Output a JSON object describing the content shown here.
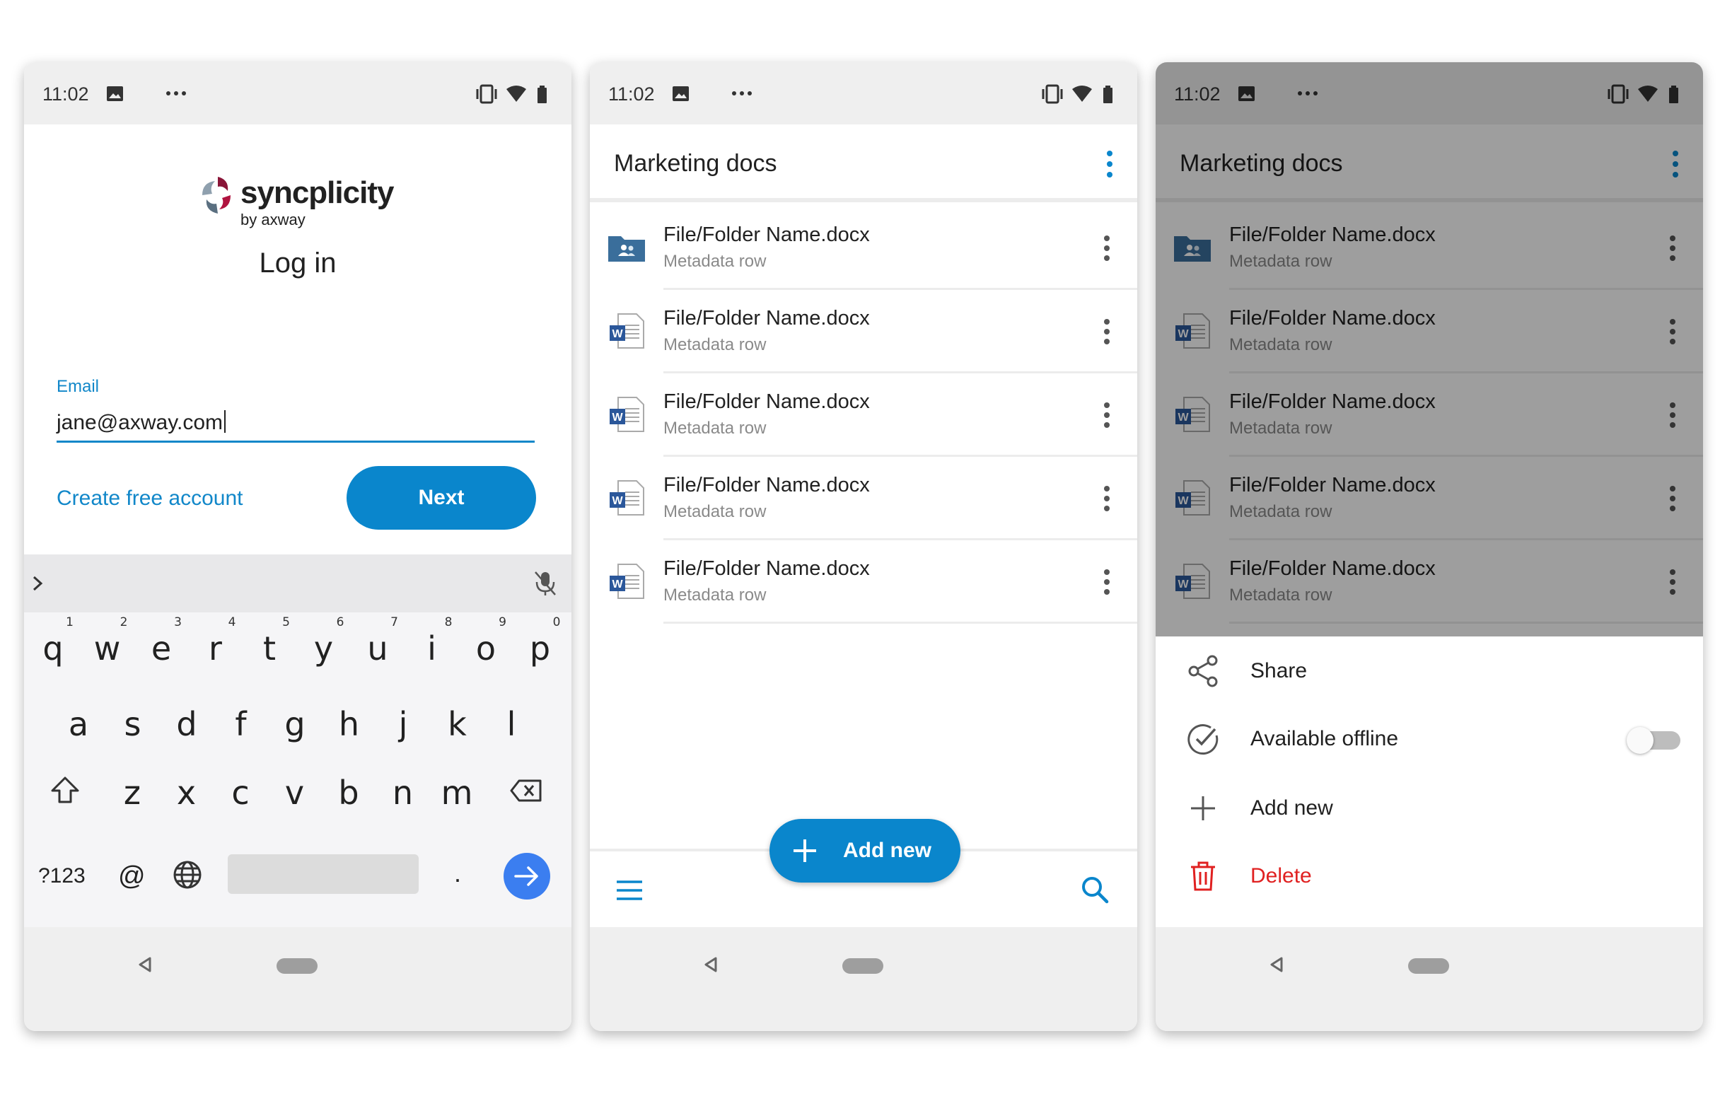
{
  "status": {
    "time": "11:02",
    "more": "···"
  },
  "login": {
    "brand": "syncplicity",
    "brand_sub": "by axway",
    "title": "Log in",
    "email_label": "Email",
    "email_value": "jane@axway.com",
    "create_account": "Create free account",
    "next": "Next"
  },
  "keyboard": {
    "row1": [
      {
        "ch": "q",
        "num": "1"
      },
      {
        "ch": "w",
        "num": "2"
      },
      {
        "ch": "e",
        "num": "3"
      },
      {
        "ch": "r",
        "num": "4"
      },
      {
        "ch": "t",
        "num": "5"
      },
      {
        "ch": "y",
        "num": "6"
      },
      {
        "ch": "u",
        "num": "7"
      },
      {
        "ch": "i",
        "num": "8"
      },
      {
        "ch": "o",
        "num": "9"
      },
      {
        "ch": "p",
        "num": "0"
      }
    ],
    "row2": [
      "a",
      "s",
      "d",
      "f",
      "g",
      "h",
      "j",
      "k",
      "l"
    ],
    "row3": [
      "z",
      "x",
      "c",
      "v",
      "b",
      "n",
      "m"
    ],
    "symbols": "?123",
    "at": "@",
    "period": "."
  },
  "list": {
    "title": "Marketing docs",
    "items": [
      {
        "name": "File/Folder Name.docx",
        "meta": "Metadata row",
        "type": "shared-folder-icon"
      },
      {
        "name": "File/Folder Name.docx",
        "meta": "Metadata row",
        "type": "word-doc-icon"
      },
      {
        "name": "File/Folder Name.docx",
        "meta": "Metadata row",
        "type": "word-doc-icon"
      },
      {
        "name": "File/Folder Name.docx",
        "meta": "Metadata row",
        "type": "word-doc-icon"
      },
      {
        "name": "File/Folder Name.docx",
        "meta": "Metadata row",
        "type": "word-doc-icon"
      }
    ],
    "fab": "Add new"
  },
  "sheet": {
    "share": "Share",
    "offline": "Available offline",
    "offline_on": false,
    "add_new": "Add new",
    "delete": "Delete"
  },
  "colors": {
    "accent": "#0a86cc",
    "danger": "#e02020",
    "link": "#1187c9",
    "folder": "#3a6e9b"
  }
}
